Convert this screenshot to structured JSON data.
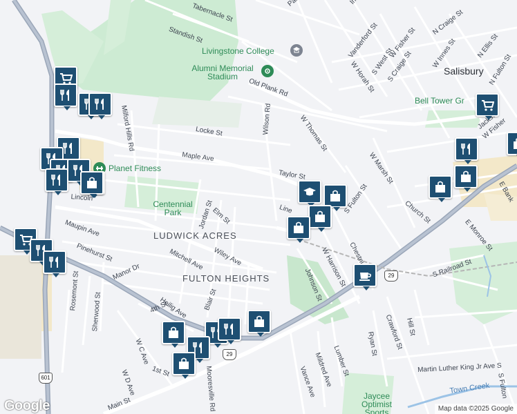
{
  "map": {
    "city": "Salisbury",
    "areas": [
      "LUDWICK ACRES",
      "FULTON HEIGHTS"
    ],
    "parks": [
      "Centennial Park"
    ],
    "pois": [
      {
        "name": "Livingstone College",
        "icon": "school-icon"
      },
      {
        "name": "Alumni Memorial Stadium",
        "icon": "stadium-icon"
      },
      {
        "name": "Planet Fitness",
        "icon": "fitness-icon"
      },
      {
        "name": "Bell Tower Gr",
        "icon": "park-icon"
      },
      {
        "name": "Jaycee Optimist Sports",
        "icon": "sports-icon"
      }
    ],
    "waterways": [
      "Town Creek"
    ],
    "shields": [
      "601",
      "29",
      "29"
    ],
    "streets": [
      "Tabernacle St",
      "Standish St",
      "Institute",
      "Park",
      "N Craige St",
      "Vanderford St",
      "W Fisher St",
      "W Innes St",
      "S West St",
      "S Craige St",
      "W Horah St",
      "N Ellis St",
      "N Fulton St",
      "Old Plank Rd",
      "Milford Hills Rd",
      "Locke St",
      "Maple Ave",
      "Wilson Rd",
      "W Thomas St",
      "Taylor St",
      "W Marsh St",
      "S Fulton St",
      "Jackson",
      "W Fisher",
      "E Bank",
      "Jordan St",
      "Elm St",
      "Lincoln",
      "Line",
      "Church St",
      "E Monroe St",
      "Maupin Ave",
      "Pinehurst St",
      "Manor Dr",
      "Mitchell Ave",
      "Wiley Ave",
      "W Harrison St",
      "Chestnut",
      "S Railroad St",
      "Rosemont St",
      "Sherwood St",
      "Johnson St",
      "4th St",
      "Heilig Ave",
      "Blair St",
      "W C Ave",
      "1st St",
      "W D Ave",
      "Mooresville Rd",
      "Mildred Ave",
      "Lumber St",
      "Ryan St",
      "Crawford St",
      "Hill St",
      "Martin Luther King Jr Ave S",
      "Vance Ave",
      "Main St",
      "S Fulton"
    ]
  },
  "markers": [
    {
      "icon": "shopping-cart-icon"
    },
    {
      "icon": "restaurant-icon"
    },
    {
      "icon": "restaurant-icon"
    },
    {
      "icon": "restaurant-icon"
    },
    {
      "icon": "restaurant-icon"
    },
    {
      "icon": "restaurant-icon"
    },
    {
      "icon": "restaurant-icon"
    },
    {
      "icon": "restaurant-icon"
    },
    {
      "icon": "shopping-bag-icon"
    },
    {
      "icon": "restaurant-icon"
    },
    {
      "icon": "shopping-bag-icon"
    },
    {
      "icon": "shopping-cart-icon"
    },
    {
      "icon": "restaurant-icon"
    },
    {
      "icon": "restaurant-icon"
    },
    {
      "icon": "education-icon"
    },
    {
      "icon": "shopping-bag-icon"
    },
    {
      "icon": "shopping-bag-icon"
    },
    {
      "icon": "shopping-bag-icon"
    },
    {
      "icon": "coffee-icon"
    },
    {
      "icon": "shopping-cart-icon"
    },
    {
      "icon": "restaurant-icon"
    },
    {
      "icon": "shopping-bag-icon"
    },
    {
      "icon": "shopping-bag-icon"
    },
    {
      "icon": "shopping-bag-icon"
    },
    {
      "icon": "restaurant-icon"
    },
    {
      "icon": "restaurant-icon"
    },
    {
      "icon": "shopping-bag-icon"
    },
    {
      "icon": "restaurant-icon"
    },
    {
      "icon": "shopping-bag-icon"
    },
    {
      "icon": "shopping-bag-icon"
    }
  ],
  "attribution": {
    "logo": "Google",
    "text": "Map data ©2025 Google"
  }
}
